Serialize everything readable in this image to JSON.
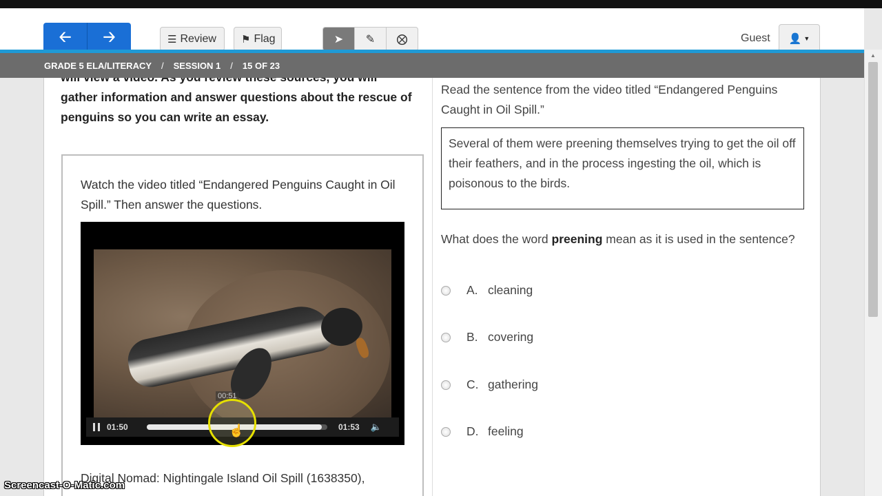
{
  "toolbar": {
    "back_icon": "arrow-left-icon",
    "forward_icon": "arrow-right-icon",
    "review_label": "Review",
    "flag_label": "Flag",
    "user_name": "Guest",
    "colors": {
      "nav": "#1a6fd6",
      "accent": "#1f9ad6",
      "breadcrumb_bg": "#6c6c6c"
    }
  },
  "breadcrumb": {
    "test": "GRADE 5 ELA/LITERACY",
    "session": "SESSION 1",
    "position": "15 OF 23",
    "separator": "/"
  },
  "passage": {
    "intro": "will view a video. As you review these sources, you will gather information and answer questions about the rescue of penguins so you can write an essay.",
    "watch_instructions": "Watch the video titled “Endangered Penguins Caught in Oil Spill.” Then answer the questions.",
    "source_credit": "Digital Nomad: Nightingale Island Oil Spill (1638350),"
  },
  "video": {
    "current_time": "01:50",
    "total_time": "01:53",
    "hover_time": "00:51",
    "progress": 0.97
  },
  "question": {
    "prompt": "Read the sentence from the video titled “Endangered Penguins Caught in Oil Spill.”",
    "quote": "Several of them were preening themselves trying to get the oil off their feathers, and in the process ingesting the oil, which is poisonous to the birds.",
    "stem_before": "What does the word ",
    "stem_keyword": "preening",
    "stem_after": " mean as it is used in the sentence?",
    "options": [
      {
        "letter": "A.",
        "text": "cleaning"
      },
      {
        "letter": "B.",
        "text": "covering"
      },
      {
        "letter": "C.",
        "text": "gathering"
      },
      {
        "letter": "D.",
        "text": "feeling"
      }
    ]
  },
  "watermark": "Screencast-O-Matic.com"
}
